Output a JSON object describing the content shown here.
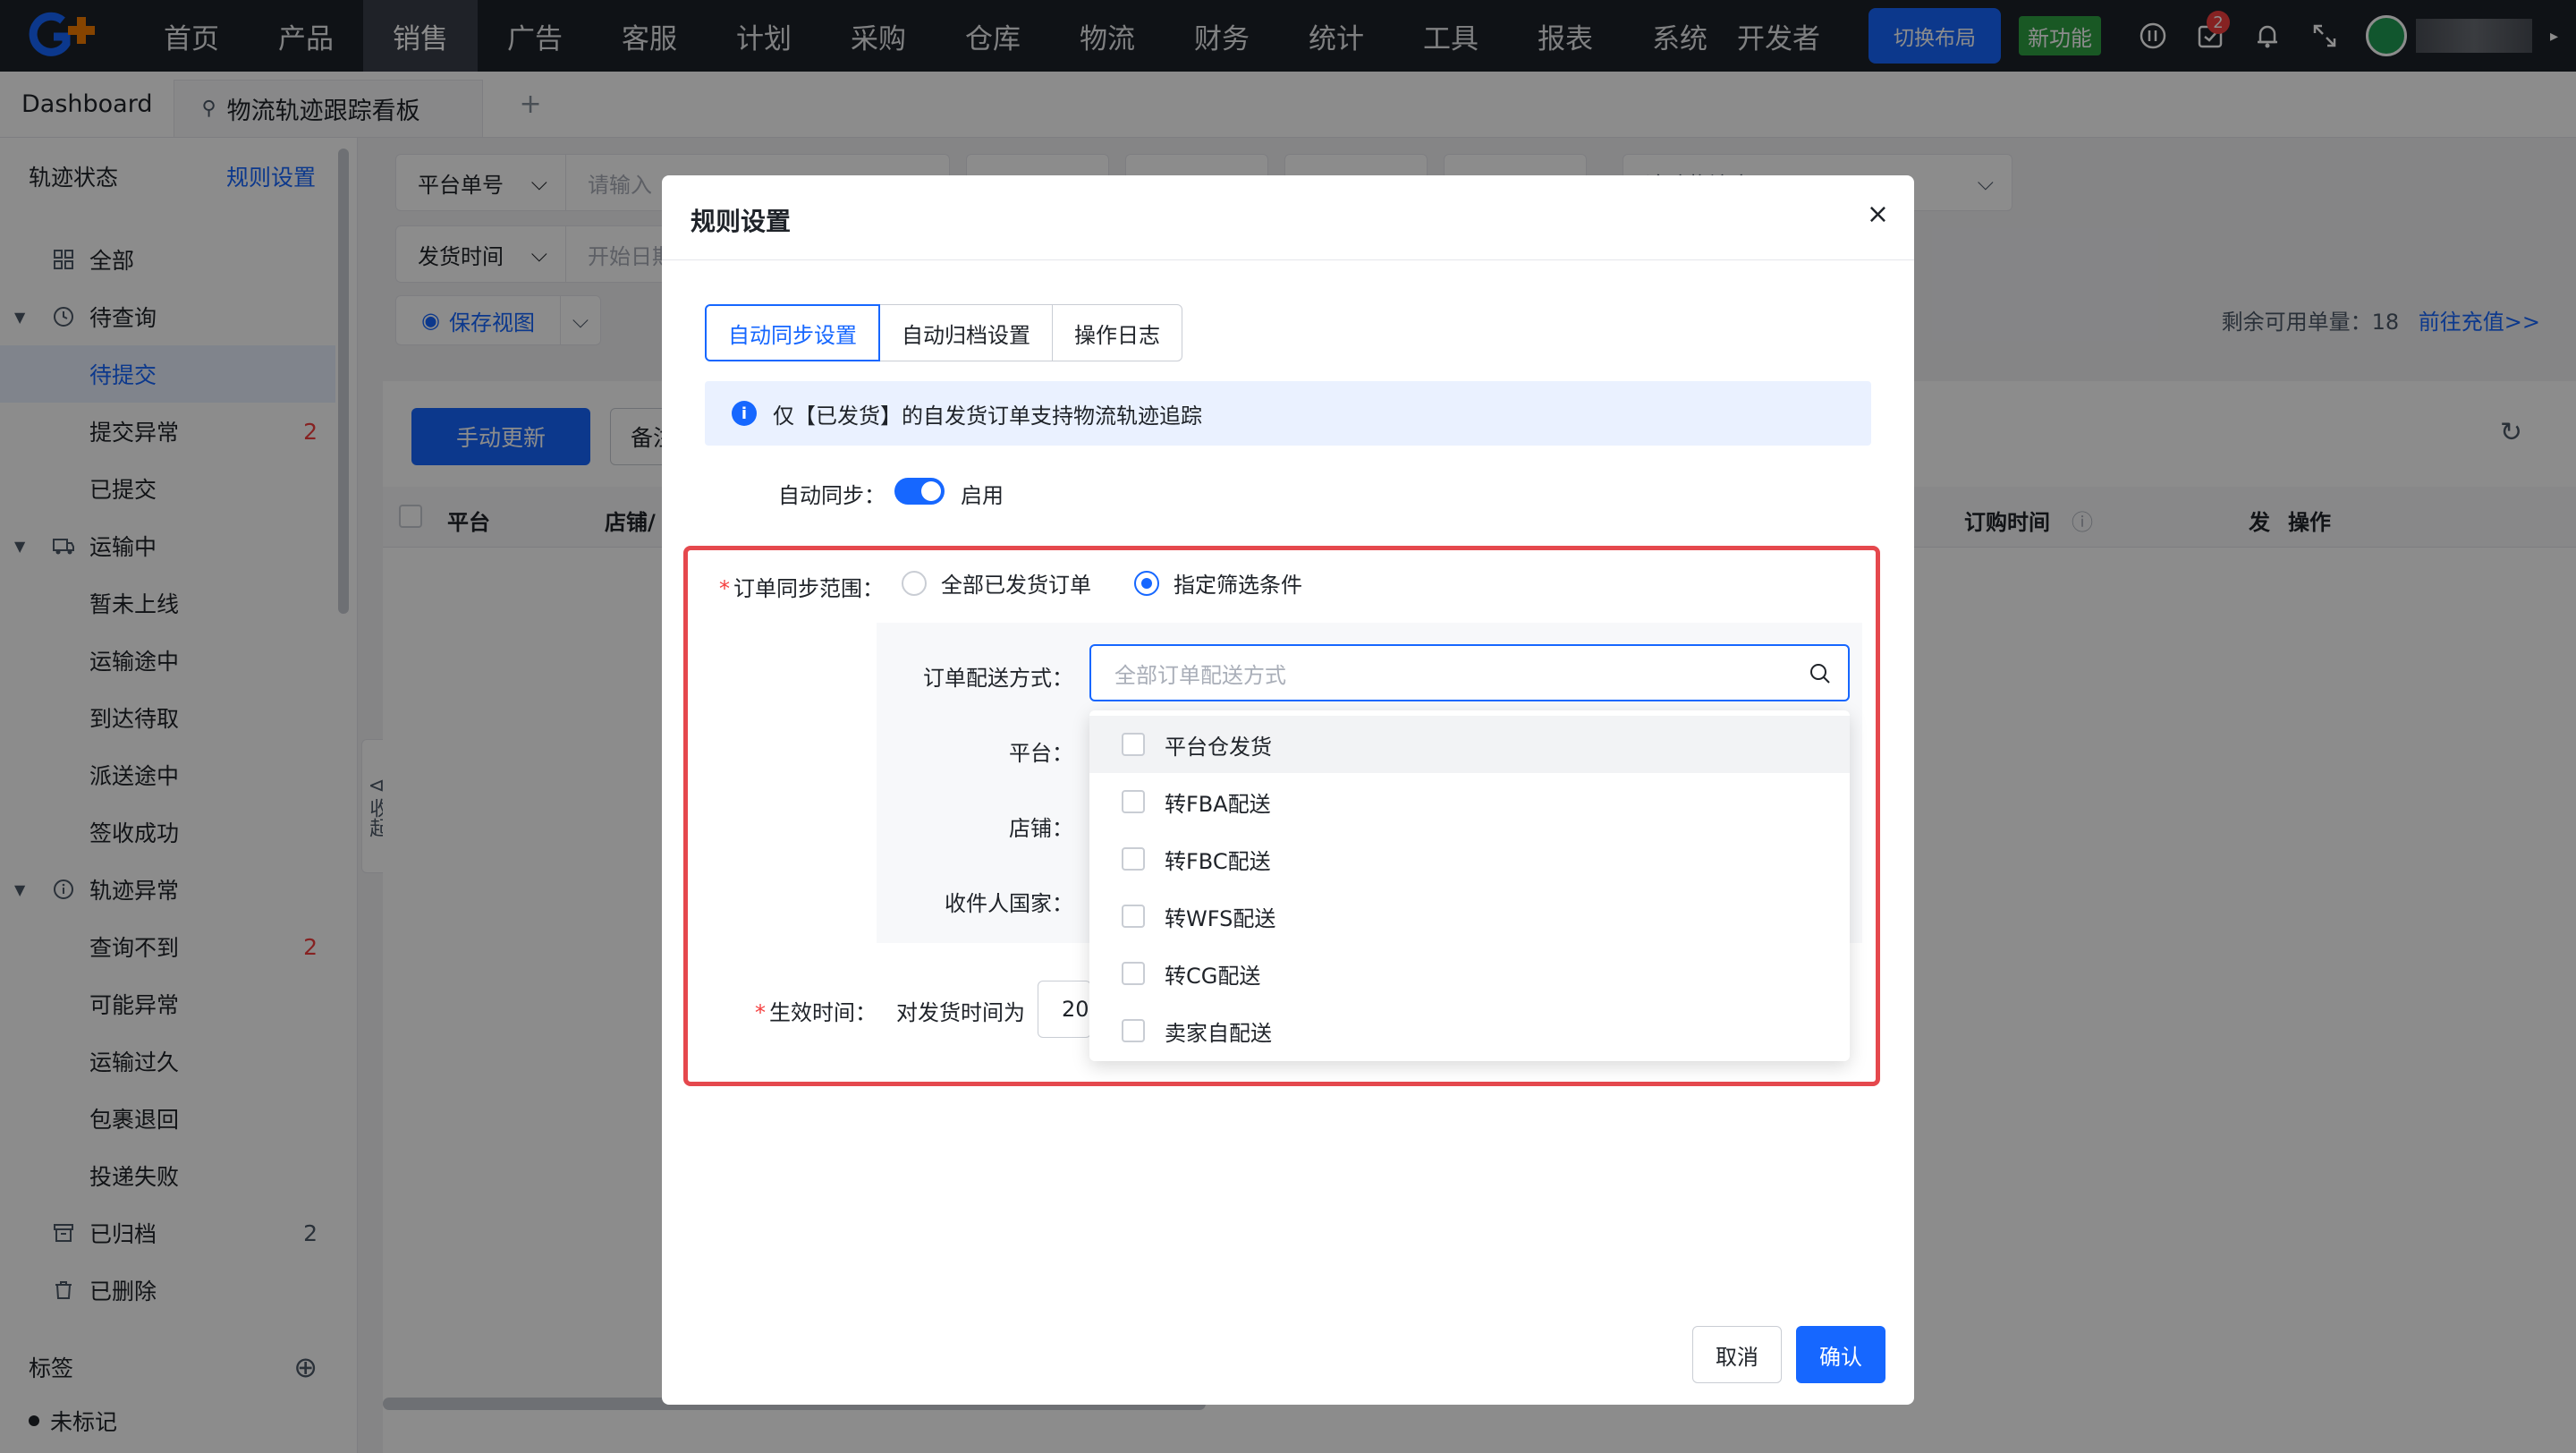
{
  "nav": {
    "items": [
      "首页",
      "产品",
      "销售",
      "广告",
      "客服",
      "计划",
      "采购",
      "仓库",
      "物流",
      "财务",
      "统计",
      "工具",
      "报表",
      "系统",
      "开发者"
    ],
    "active": "销售",
    "layout_button": "切换布局",
    "new_feature": "新功能",
    "todo_badge": "2"
  },
  "tabs": {
    "dashboard": "Dashboard",
    "active": "物流轨迹跟踪看板",
    "add": "+"
  },
  "sidebar": {
    "title": "轨迹状态",
    "rule_link": "规则设置",
    "items": [
      {
        "label": "全部",
        "count": ""
      },
      {
        "label": "待查询",
        "count": ""
      },
      {
        "label": "待提交",
        "count": ""
      },
      {
        "label": "提交异常",
        "count": "2"
      },
      {
        "label": "已提交",
        "count": ""
      },
      {
        "label": "运输中",
        "count": ""
      },
      {
        "label": "暂未上线",
        "count": ""
      },
      {
        "label": "运输途中",
        "count": ""
      },
      {
        "label": "到达待取",
        "count": ""
      },
      {
        "label": "派送途中",
        "count": ""
      },
      {
        "label": "签收成功",
        "count": ""
      },
      {
        "label": "轨迹异常",
        "count": ""
      },
      {
        "label": "查询不到",
        "count": "2"
      },
      {
        "label": "可能异常",
        "count": ""
      },
      {
        "label": "运输过久",
        "count": ""
      },
      {
        "label": "包裹退回",
        "count": ""
      },
      {
        "label": "投递失败",
        "count": ""
      },
      {
        "label": "已归档",
        "count": "2"
      },
      {
        "label": "已删除",
        "count": ""
      }
    ],
    "tags_title": "标签",
    "tag_item": "未标记",
    "collapse": "收起"
  },
  "filters": {
    "platform_order": "平台单号",
    "input_placeholder": "请输入",
    "ship_time": "发货时间",
    "start_placeholder": "开始日期",
    "carrier": "追踪物流商",
    "save_view": "保存视图",
    "remain_label": "剩余可用单量：",
    "remain_value": "18",
    "recharge": "前往充值>>"
  },
  "toolbar": {
    "manual_update": "手动更新",
    "remark": "备注"
  },
  "table": {
    "col_platform": "平台",
    "col_store": "店铺/",
    "col_order_time": "订购时间",
    "col_ship": "发",
    "col_action": "操作"
  },
  "modal": {
    "title": "规则设置",
    "close": "×",
    "tabs": [
      "自动同步设置",
      "自动归档设置",
      "操作日志"
    ],
    "info": "仅【已发货】的自发货订单支持物流轨迹追踪",
    "auto_sync_label": "自动同步：",
    "auto_sync_state": "启用",
    "scope_label": "订单同步范围：",
    "scope_all": "全部已发货订单",
    "scope_custom": "指定筛选条件",
    "delivery_label": "订单配送方式：",
    "delivery_placeholder": "全部订单配送方式",
    "platform_label": "平台：",
    "store_label": "店铺：",
    "country_label": "收件人国家：",
    "effective_label": "生效时间：",
    "effective_prefix": "对发货时间为",
    "effective_date": "20",
    "options": [
      "平台仓发货",
      "转FBA配送",
      "转FBC配送",
      "转WFS配送",
      "转CG配送",
      "卖家自配送"
    ],
    "cancel": "取消",
    "confirm": "确认"
  },
  "colors": {
    "primary": "#1667ff",
    "highlight": "#e5484d",
    "nav_bg": "#1d2129",
    "new_feature": "#2ea043"
  }
}
